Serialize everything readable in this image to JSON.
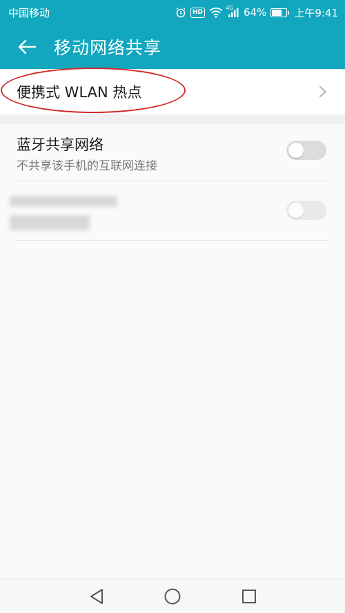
{
  "status_bar": {
    "carrier": "中国移动",
    "network": "4G",
    "battery": "64%",
    "time": "上午9:41",
    "icons": [
      "alarm-icon",
      "hd-icon",
      "wifi-icon",
      "signal-icon",
      "battery-icon"
    ],
    "hd_label": "HD",
    "battery_level": 0.64
  },
  "header": {
    "title": "移动网络共享",
    "back_icon": "back-arrow-icon"
  },
  "list": {
    "wlan_hotspot": {
      "label": "便携式 WLAN 热点",
      "icon": "chevron-right-icon"
    },
    "bluetooth": {
      "title": "蓝牙共享网络",
      "subtitle": "不共享该手机的互联网连接",
      "toggle_on": false
    },
    "usb": {
      "toggle_on": false
    }
  },
  "nav_bar": {
    "icons": [
      "back-triangle-icon",
      "home-circle-icon",
      "recents-square-icon"
    ]
  },
  "colors": {
    "accent": "#12a7be",
    "annotation": "#d12a2a"
  }
}
